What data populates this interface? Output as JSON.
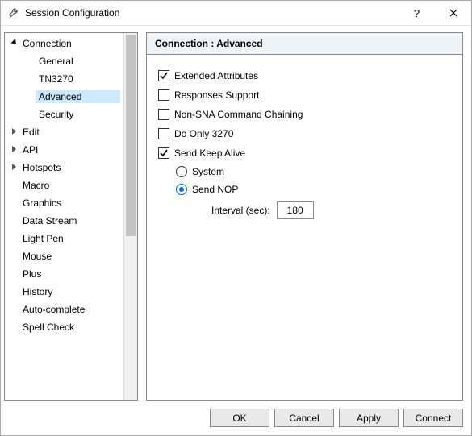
{
  "window": {
    "title": "Session Configuration"
  },
  "tree": {
    "items": [
      {
        "label": "Connection",
        "kind": "root",
        "state": "expanded"
      },
      {
        "label": "General",
        "kind": "child",
        "state": "none"
      },
      {
        "label": "TN3270",
        "kind": "child",
        "state": "none"
      },
      {
        "label": "Advanced",
        "kind": "child",
        "state": "none",
        "selected": true
      },
      {
        "label": "Security",
        "kind": "child",
        "state": "none"
      },
      {
        "label": "Edit",
        "kind": "root",
        "state": "collapsed"
      },
      {
        "label": "API",
        "kind": "root",
        "state": "collapsed"
      },
      {
        "label": "Hotspots",
        "kind": "root",
        "state": "collapsed"
      },
      {
        "label": "Macro",
        "kind": "root",
        "state": "none"
      },
      {
        "label": "Graphics",
        "kind": "root",
        "state": "none"
      },
      {
        "label": "Data Stream",
        "kind": "root",
        "state": "none"
      },
      {
        "label": "Light Pen",
        "kind": "root",
        "state": "none"
      },
      {
        "label": "Mouse",
        "kind": "root",
        "state": "none"
      },
      {
        "label": "Plus",
        "kind": "root",
        "state": "none"
      },
      {
        "label": "History",
        "kind": "root",
        "state": "none"
      },
      {
        "label": "Auto-complete",
        "kind": "root",
        "state": "none"
      },
      {
        "label": "Spell Check",
        "kind": "root",
        "state": "none"
      }
    ]
  },
  "panel": {
    "title": "Connection : Advanced",
    "checkboxes": {
      "extended_attributes": {
        "label": "Extended Attributes",
        "checked": true
      },
      "responses_support": {
        "label": "Responses Support",
        "checked": false
      },
      "non_sna_chaining": {
        "label": "Non-SNA Command Chaining",
        "checked": false
      },
      "do_only_3270": {
        "label": "Do Only 3270",
        "checked": false
      },
      "send_keep_alive": {
        "label": "Send Keep Alive",
        "checked": true
      }
    },
    "keep_alive": {
      "options": {
        "system": {
          "label": "System",
          "checked": false
        },
        "send_nop": {
          "label": "Send NOP",
          "checked": true
        }
      },
      "interval_label": "Interval (sec):",
      "interval_value": "180"
    }
  },
  "buttons": {
    "ok": "OK",
    "cancel": "Cancel",
    "apply": "Apply",
    "connect": "Connect"
  }
}
